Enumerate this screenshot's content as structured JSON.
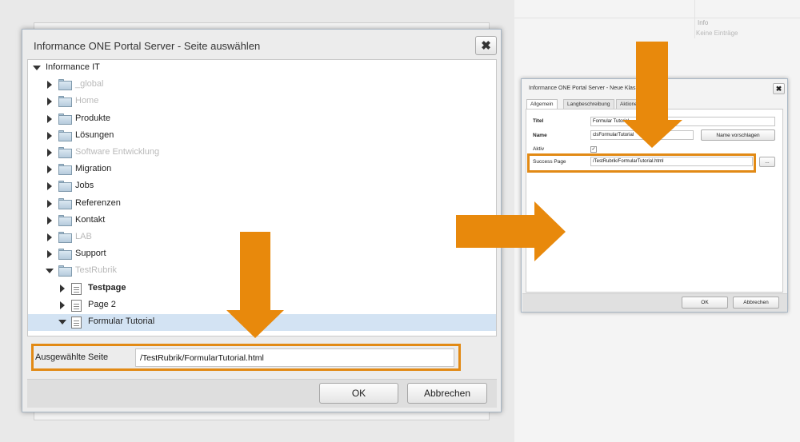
{
  "background": {
    "info_label": "Info",
    "no_entries_label": "Keine Einträge"
  },
  "dialog": {
    "title": "Informance ONE Portal Server - Seite auswählen",
    "close_glyph": "✖",
    "tree": [
      {
        "label": "Informance IT",
        "type": "root",
        "expanded": true,
        "dim": false
      },
      {
        "label": "_global",
        "type": "folder",
        "dim": true
      },
      {
        "label": "Home",
        "type": "folder",
        "dim": true
      },
      {
        "label": "Produkte",
        "type": "folder",
        "dim": false
      },
      {
        "label": "Lösungen",
        "type": "folder",
        "dim": false
      },
      {
        "label": "Software Entwicklung",
        "type": "folder",
        "dim": true
      },
      {
        "label": "Migration",
        "type": "folder",
        "dim": false
      },
      {
        "label": "Jobs",
        "type": "folder",
        "dim": false
      },
      {
        "label": "Referenzen",
        "type": "folder",
        "dim": false
      },
      {
        "label": "Kontakt",
        "type": "folder",
        "dim": false
      },
      {
        "label": "LAB",
        "type": "folder",
        "dim": true
      },
      {
        "label": "Support",
        "type": "folder",
        "dim": false
      },
      {
        "label": "TestRubrik",
        "type": "folder",
        "expanded": true,
        "dim": true
      },
      {
        "label": "Testpage",
        "type": "page",
        "bold": true
      },
      {
        "label": "Page 2",
        "type": "page"
      },
      {
        "label": "Formular Tutorial",
        "type": "page",
        "expanded": true,
        "selected": true
      }
    ],
    "selected_page_label": "Ausgewählte Seite",
    "selected_page_value": "/TestRubrik/FormularTutorial.html",
    "ok_label": "OK",
    "cancel_label": "Abbrechen"
  },
  "small_dialog": {
    "title": "Informance ONE Portal Server - Neue Klas",
    "close_glyph": "✖",
    "tabs": [
      "Allgemein",
      "Langbeschreibung",
      "Aktione"
    ],
    "fields": {
      "titel_label": "Titel",
      "titel_value": "Formular Tutorial",
      "name_label": "Name",
      "name_value": "clsFormularTutorial",
      "suggest_label": "Name vorschlagen",
      "aktiv_label": "Aktiv",
      "aktiv_checked": true,
      "success_label": "Success Page",
      "success_value": "/TestRubrik/FormularTutorial.html",
      "browse_label": "..."
    },
    "ok_label": "OK",
    "cancel_label": "Abbrechen"
  },
  "colors": {
    "highlight": "#e28a15",
    "arrow": "#e8890c",
    "selection": "#d3e3f3"
  }
}
